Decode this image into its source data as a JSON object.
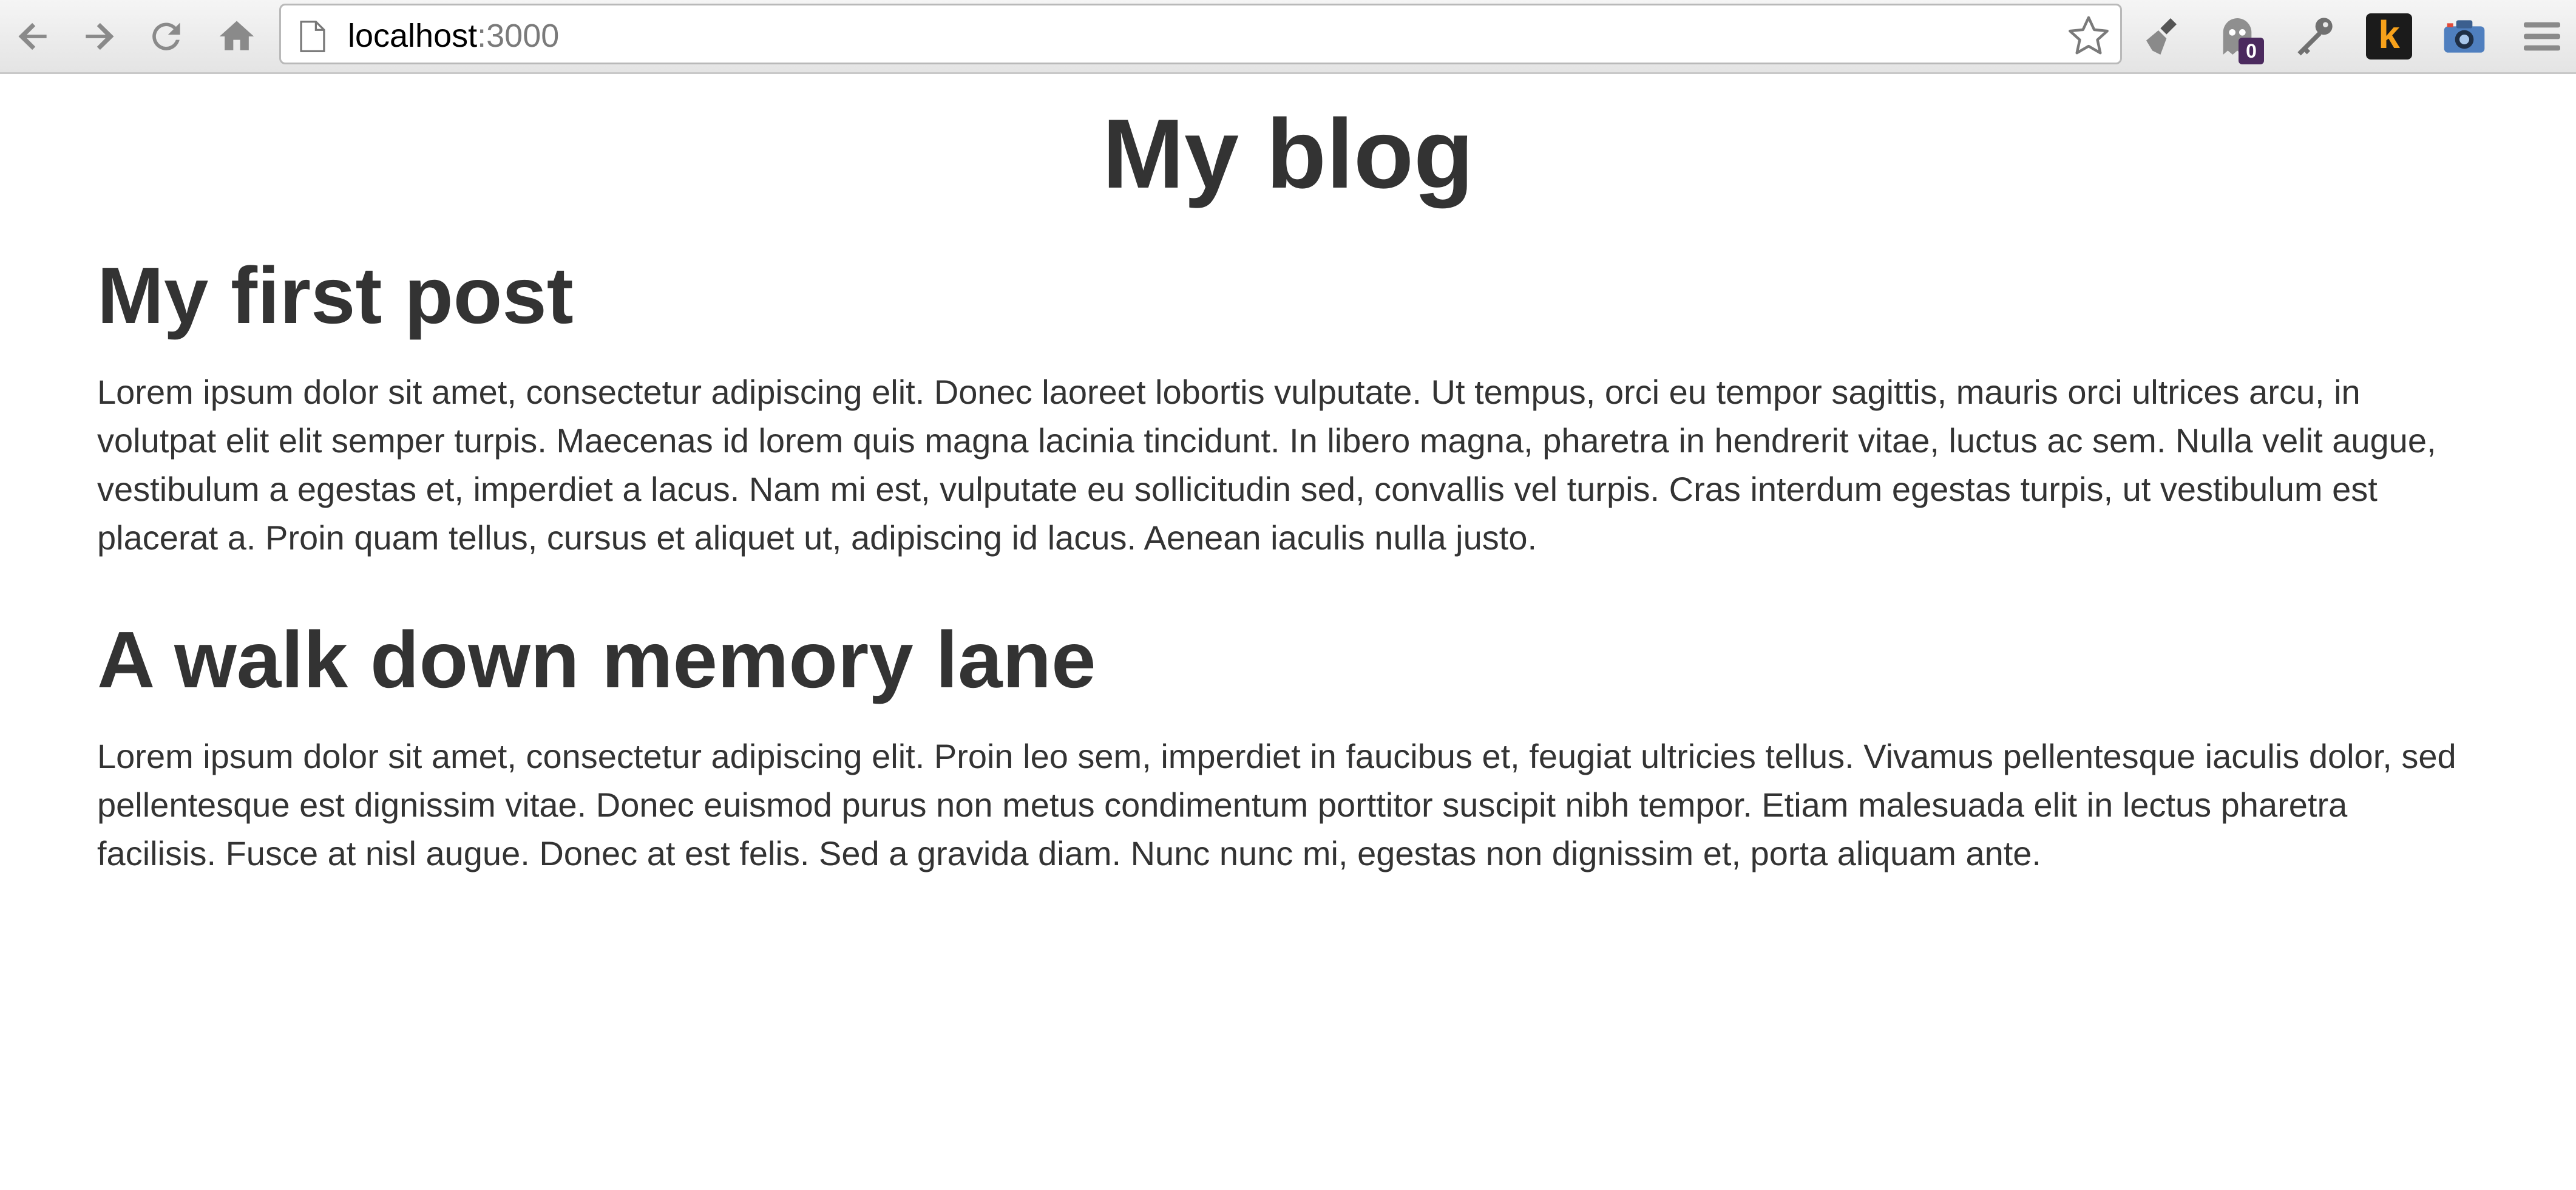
{
  "browser": {
    "url_host": "localhost",
    "url_port": ":3000",
    "extension_badge_count": "0",
    "klout_letter": "k",
    "icons": {
      "back": "back-arrow-icon",
      "forward": "forward-arrow-icon",
      "reload": "reload-icon",
      "home": "home-icon",
      "page": "page-icon",
      "bookmark": "star-icon",
      "ext1": "broom-icon",
      "ext2": "ghostery-icon",
      "ext3": "key-icon",
      "ext4": "klout-icon",
      "ext5": "camera-icon",
      "menu": "hamburger-menu-icon"
    },
    "colors": {
      "badge": "#4b2a5e",
      "klout_bg": "#1b1b1b",
      "klout_letter": "#f7a11a"
    }
  },
  "page": {
    "title": "My blog",
    "posts": [
      {
        "title": "My first post",
        "body": "Lorem ipsum dolor sit amet, consectetur adipiscing elit. Donec laoreet lobortis vulputate. Ut tempus, orci eu tempor sagittis, mauris orci ultrices arcu, in volutpat elit elit semper turpis. Maecenas id lorem quis magna lacinia tincidunt. In libero magna, pharetra in hendrerit vitae, luctus ac sem. Nulla velit augue, vestibulum a egestas et, imperdiet a lacus. Nam mi est, vulputate eu sollicitudin sed, convallis vel turpis. Cras interdum egestas turpis, ut vestibulum est placerat a. Proin quam tellus, cursus et aliquet ut, adipiscing id lacus. Aenean iaculis nulla justo."
      },
      {
        "title": "A walk down memory lane",
        "body": "Lorem ipsum dolor sit amet, consectetur adipiscing elit. Proin leo sem, imperdiet in faucibus et, feugiat ultricies tellus. Vivamus pellentesque iaculis dolor, sed pellentesque est dignissim vitae. Donec euismod purus non metus condimentum porttitor suscipit nibh tempor. Etiam malesuada elit in lectus pharetra facilisis. Fusce at nisl augue. Donec at est felis. Sed a gravida diam. Nunc nunc mi, egestas non dignissim et, porta aliquam ante."
      }
    ]
  },
  "colors": {
    "text": "#333333",
    "background": "#ffffff"
  }
}
